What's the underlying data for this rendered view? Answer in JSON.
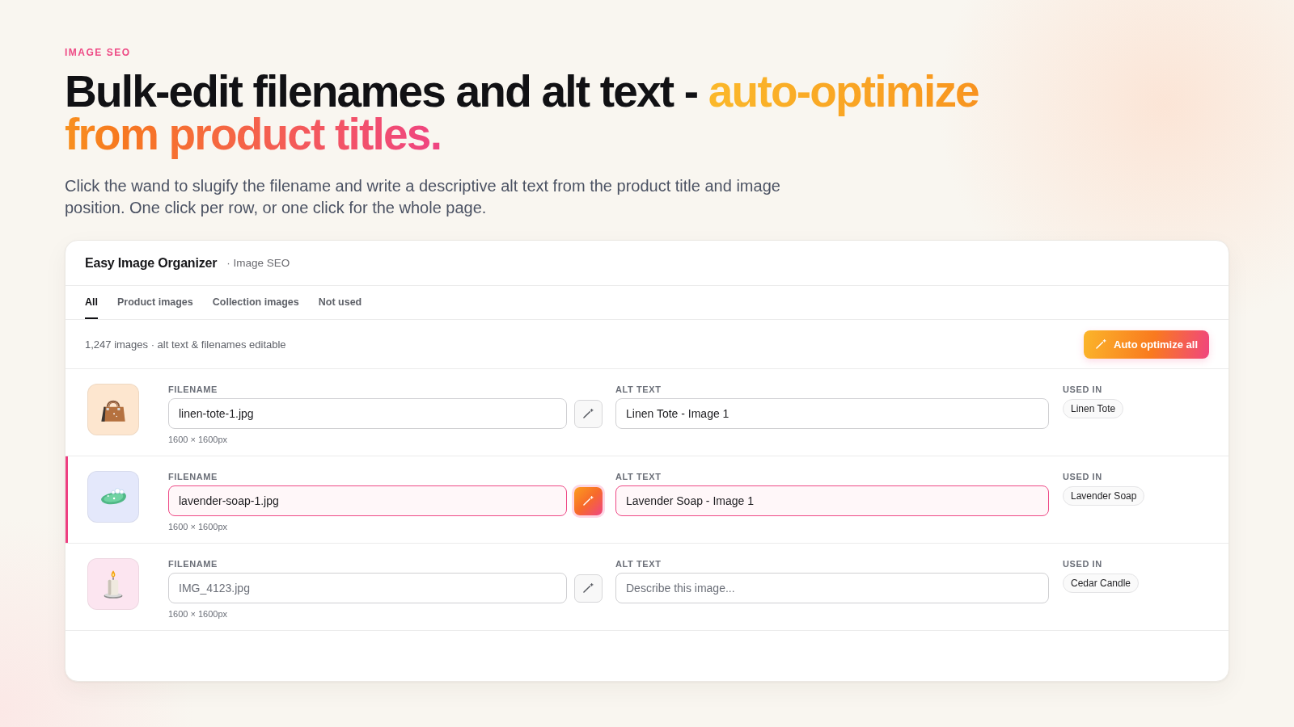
{
  "eyebrow": "IMAGE SEO",
  "headline": {
    "text": "Bulk-edit filenames and alt text - ",
    "highlight": "auto-optimize from product titles."
  },
  "description": "Click the wand to slugify the filename and write a descriptive alt text from the product title and image position. One click per row, or one click for the whole page.",
  "app": {
    "name": "Easy Image Organizer",
    "section": "· Image SEO"
  },
  "tabs": [
    {
      "label": "All",
      "selected": true
    },
    {
      "label": "Product images",
      "selected": false
    },
    {
      "label": "Collection images",
      "selected": false
    },
    {
      "label": "Not used",
      "selected": false
    }
  ],
  "toolbar": {
    "summary": "1,247 images · alt text & filenames editable",
    "button": "Auto optimize all"
  },
  "rows": [
    {
      "selected": false,
      "color": "#fde6cf",
      "filename_label": "FILENAME",
      "filename": {
        "value": "linen-tote-1.jpg"
      },
      "dimensions": "1600 × 1600px",
      "alt_label": "ALT TEXT",
      "alt": {
        "value": "Linen Tote - Image 1"
      },
      "used_label": "USED IN",
      "used_in": [
        "Linen Tote"
      ]
    },
    {
      "selected": true,
      "color": "#e4e8fb",
      "filename_label": "FILENAME",
      "filename": {
        "value": "lavender-soap-1.jpg"
      },
      "dimensions": "1600 × 1600px",
      "alt_label": "ALT TEXT",
      "alt": {
        "value": "Lavender Soap - Image 1"
      },
      "used_label": "USED IN",
      "used_in": [
        "Lavender Soap"
      ]
    },
    {
      "selected": false,
      "color": "#fce5f0",
      "filename_label": "FILENAME",
      "filename": {
        "placeholder": "IMG_4123.jpg"
      },
      "dimensions": "1600 × 1600px",
      "alt_label": "ALT TEXT",
      "alt": {
        "placeholder": "Describe this image..."
      },
      "used_label": "USED IN",
      "used_in": [
        "Cedar Candle"
      ]
    }
  ]
}
